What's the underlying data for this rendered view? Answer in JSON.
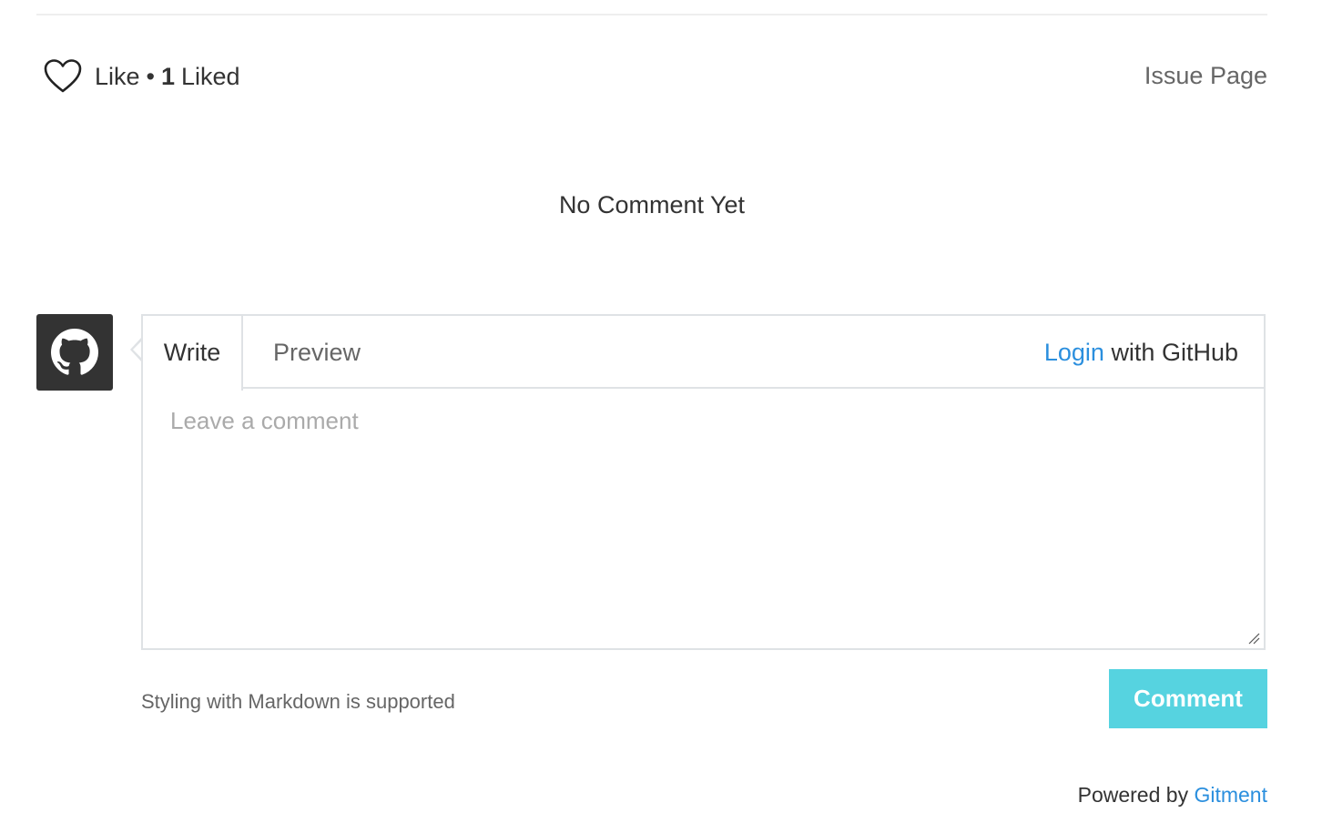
{
  "header": {
    "like_label": "Like",
    "like_separator": "•",
    "liked_count": "1",
    "liked_label": "Liked",
    "issue_link": "Issue Page"
  },
  "comments": {
    "empty_message": "No Comment Yet"
  },
  "editor": {
    "tab_write": "Write",
    "tab_preview": "Preview",
    "login_link": "Login",
    "login_suffix": "with GitHub",
    "placeholder": "Leave a comment",
    "value": ""
  },
  "footer": {
    "markdown_note": "Styling with Markdown is supported",
    "comment_button": "Comment",
    "powered_by": "Powered by",
    "powered_link": "Gitment"
  },
  "icons": {
    "heart": "heart-icon",
    "avatar": "github-icon",
    "resize": "resize-handle-icon"
  },
  "colors": {
    "link": "#2b8fde",
    "button": "#56d3e0",
    "avatar_bg": "#333333",
    "border": "#dfe2e5"
  }
}
